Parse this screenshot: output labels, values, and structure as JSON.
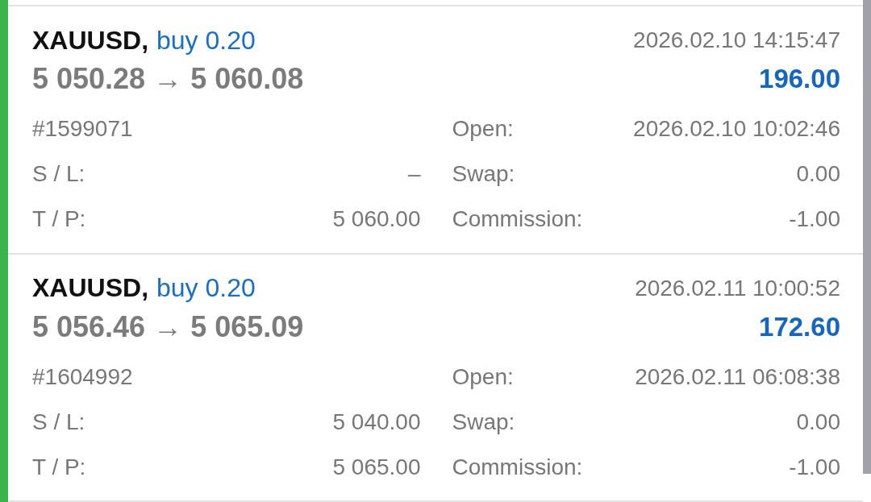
{
  "trades": [
    {
      "symbol": "XAUUSD,",
      "order": "buy 0.20",
      "close_time": "2026.02.10 14:15:47",
      "prices": "5 050.28 → 5 060.08",
      "profit": "196.00",
      "details": [
        {
          "left_label": "#1599071",
          "right_label": "Open:",
          "right_value": "2026.02.10 10:02:46"
        },
        {
          "left_label": "S / L:",
          "left_value": "–",
          "right_label": "Swap:",
          "right_value": "0.00"
        },
        {
          "left_label": "T / P:",
          "left_value": "5 060.00",
          "right_label": "Commission:",
          "right_value": "-1.00"
        }
      ]
    },
    {
      "symbol": "XAUUSD,",
      "order": "buy 0.20",
      "close_time": "2026.02.11 10:00:52",
      "prices": "5 056.46 → 5 065.09",
      "profit": "172.60",
      "details": [
        {
          "left_label": "#1604992",
          "right_label": "Open:",
          "right_value": "2026.02.11 06:08:38"
        },
        {
          "left_label": "S / L:",
          "left_value": "5 040.00",
          "right_label": "Swap:",
          "right_value": "0.00"
        },
        {
          "left_label": "T / P:",
          "left_value": "5 065.00",
          "right_label": "Commission:",
          "right_value": "-1.00"
        }
      ]
    }
  ]
}
